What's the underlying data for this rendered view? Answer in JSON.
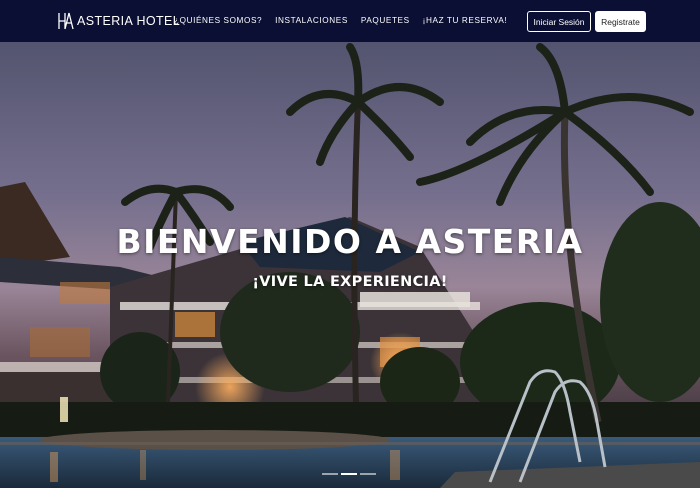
{
  "brand": {
    "name": "ASTERIA HOTEL",
    "logo_icon": "ha-monogram-icon"
  },
  "nav": {
    "links": [
      {
        "label": "¿QUIÉNES SOMOS?"
      },
      {
        "label": "INSTALACIONES"
      },
      {
        "label": "PAQUETES"
      },
      {
        "label": "¡HAZ TU RESERVA!"
      }
    ],
    "login_label": "Iniciar Sesión",
    "register_label": "Registrate"
  },
  "hero": {
    "title": "BIENVENIDO A ASTERIA",
    "subtitle": "¡VIVE LA EXPERIENCIA!",
    "slides": 3,
    "active_slide": 1
  },
  "colors": {
    "navbar": "#0b0f33",
    "text": "#ffffff"
  }
}
